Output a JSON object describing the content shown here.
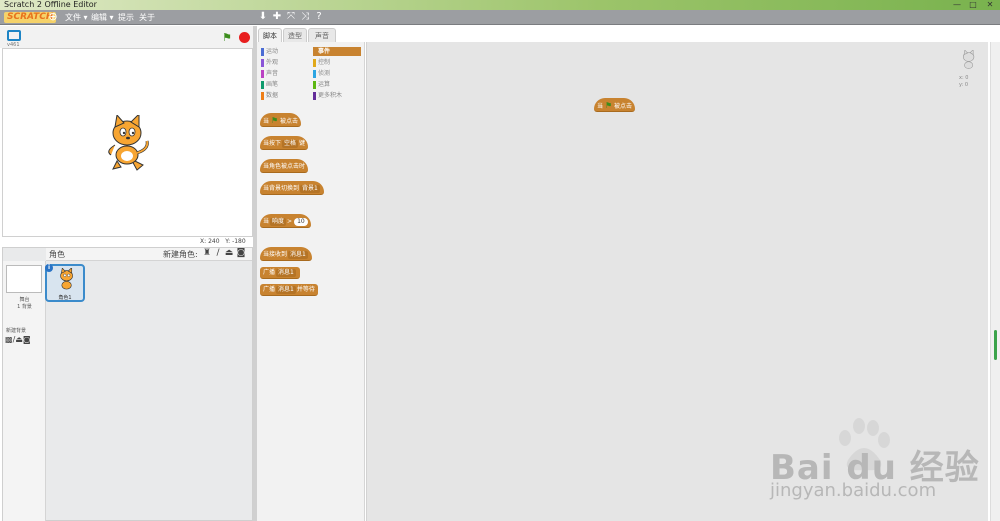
{
  "window": {
    "title": "Scratch 2 Offline Editor",
    "minimize": "—",
    "maximize": "□",
    "close": "✕"
  },
  "menubar": {
    "logo": "SCRATCH",
    "items": [
      "文件 ▾",
      "编辑 ▾",
      "提示",
      "关于"
    ],
    "toolbar_icons": [
      "duplicate-icon",
      "delete-icon",
      "grow-icon",
      "shrink-icon",
      "help-icon"
    ]
  },
  "stage": {
    "version": "v461",
    "coords": {
      "x_label": "X:",
      "x": "240",
      "y_label": "Y:",
      "y": "-180"
    }
  },
  "sprites": {
    "header_label": "角色",
    "new_sprite_label": "新建角色:",
    "stage_label": "舞台",
    "stage_backdrops": "1 背景",
    "new_backdrop_label": "新建背景",
    "items": [
      {
        "name": "角色1"
      }
    ]
  },
  "tabs": [
    "脚本",
    "造型",
    "声音"
  ],
  "categories": [
    {
      "label": "运动",
      "color": "#4a6cd4"
    },
    {
      "label": "事件",
      "color": "#c88330",
      "active": true
    },
    {
      "label": "外观",
      "color": "#8a55d7"
    },
    {
      "label": "控制",
      "color": "#e1a91a"
    },
    {
      "label": "声音",
      "color": "#bb42c3"
    },
    {
      "label": "侦测",
      "color": "#2ca5e2"
    },
    {
      "label": "画笔",
      "color": "#0e9a6c"
    },
    {
      "label": "运算",
      "color": "#5cb712"
    },
    {
      "label": "数据",
      "color": "#ee7d16"
    },
    {
      "label": "更多积木",
      "color": "#632d99"
    }
  ],
  "blocks": {
    "when_flag": {
      "pre": "当",
      "post": "被点击"
    },
    "when_key": {
      "pre": "当按下",
      "slot": "空格",
      "post": "键"
    },
    "when_sprite_clicked": "当角色被点击时",
    "when_backdrop": {
      "pre": "当背景切换到",
      "slot": "背景1"
    },
    "when_greater": {
      "pre": "当",
      "slot": "响度",
      "op": ">",
      "num": "10"
    },
    "when_receive": {
      "pre": "当接收到",
      "slot": "消息1"
    },
    "broadcast": {
      "pre": "广播",
      "slot": "消息1"
    },
    "broadcast_wait": {
      "pre": "广播",
      "slot": "消息1",
      "post": "并等待"
    }
  },
  "script_area": {
    "block": {
      "pre": "当",
      "post": "被点击"
    },
    "sprite_x": "x: 0",
    "sprite_y": "y: 0"
  },
  "watermark": {
    "brand": "Bai du 经验",
    "url": "jingyan.baidu.com"
  }
}
